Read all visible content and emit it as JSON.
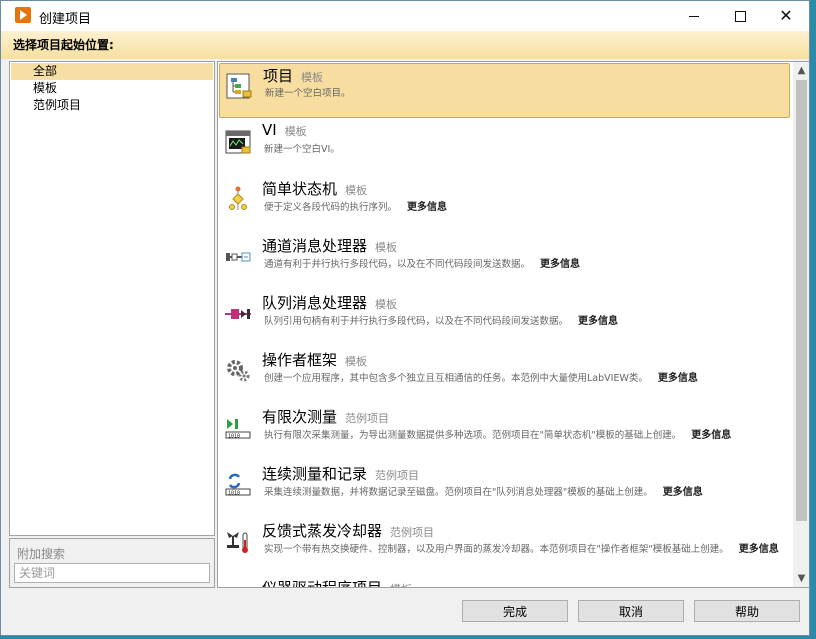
{
  "window": {
    "title": "创建项目",
    "minimize_icon": "minimize-icon",
    "maximize_icon": "maximize-icon",
    "close_icon": "close-icon"
  },
  "header": {
    "label": "选择项目起始位置:"
  },
  "categories": [
    {
      "label": "全部",
      "selected": true
    },
    {
      "label": "模板",
      "selected": false
    },
    {
      "label": "范例项目",
      "selected": false
    }
  ],
  "search": {
    "label": "附加搜索",
    "placeholder": "关键词",
    "value": ""
  },
  "items": [
    {
      "title": "项目",
      "tag": "模板",
      "desc": "新建一个空白项目。",
      "more": "",
      "icon": "project-icon",
      "selected": true
    },
    {
      "title": "VI",
      "tag": "模板",
      "desc": "新建一个空白VI。",
      "more": "",
      "icon": "vi-icon",
      "selected": false
    },
    {
      "title": "简单状态机",
      "tag": "模板",
      "desc": "便于定义各段代码的执行序列。",
      "more": "更多信息",
      "icon": "state-machine-icon",
      "selected": false
    },
    {
      "title": "通道消息处理器",
      "tag": "模板",
      "desc": "通道有利于并行执行多段代码，以及在不同代码段间发送数据。",
      "more": "更多信息",
      "icon": "channel-icon",
      "selected": false
    },
    {
      "title": "队列消息处理器",
      "tag": "模板",
      "desc": "队列引用句柄有利于并行执行多段代码，以及在不同代码段间发送数据。",
      "more": "更多信息",
      "icon": "queue-icon",
      "selected": false
    },
    {
      "title": "操作者框架",
      "tag": "模板",
      "desc": "创建一个应用程序，其中包含多个独立且互相通信的任务。本范例中大量使用LabVIEW类。",
      "more": "更多信息",
      "icon": "gears-icon",
      "selected": false
    },
    {
      "title": "有限次测量",
      "tag": "范例项目",
      "desc": "执行有限次采集测量，为导出测量数据提供多种选项。范例项目在\"简单状态机\"模板的基础上创建。",
      "more": "更多信息",
      "icon": "finite-measure-icon",
      "selected": false
    },
    {
      "title": "连续测量和记录",
      "tag": "范例项目",
      "desc": "采集连续测量数据，并将数据记录至磁盘。范例项目在\"队列消息处理器\"模板的基础上创建。",
      "more": "更多信息",
      "icon": "continuous-measure-icon",
      "selected": false
    },
    {
      "title": "反馈式蒸发冷却器",
      "tag": "范例项目",
      "desc": "实现一个带有热交换硬件、控制器，以及用户界面的蒸发冷却器。本范例项目在\"操作者框架\"模板基础上创建。",
      "more": "更多信息",
      "icon": "cooler-icon",
      "selected": false
    },
    {
      "title": "仪器驱动程序项目",
      "tag": "模板",
      "desc": "",
      "more": "",
      "icon": "instrument-driver-icon",
      "selected": false
    }
  ],
  "footer": {
    "finish": "完成",
    "cancel": "取消",
    "help": "帮助"
  },
  "colors": {
    "selection": "#f7dea0",
    "header_band": "#f6dfa0",
    "accent": "#e8740c"
  }
}
